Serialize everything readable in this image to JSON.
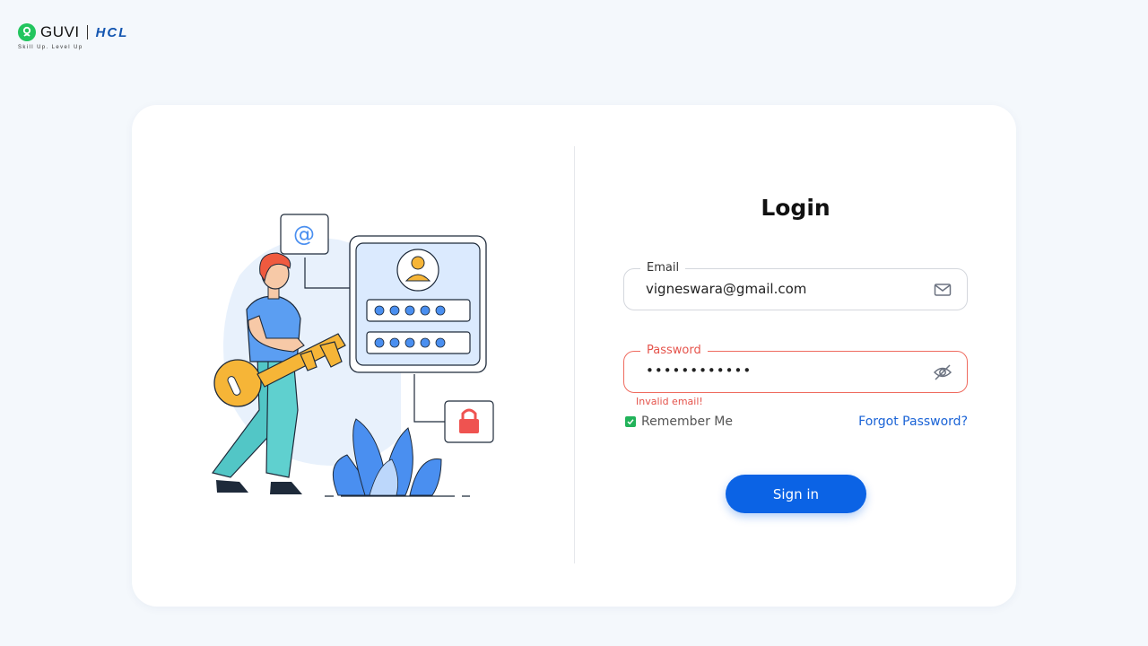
{
  "brand": {
    "name": "GUVI",
    "partner": "HCL",
    "tagline": "Skill Up. Level Up",
    "guvi_color": "#22c55e",
    "hcl_color": "#1255b0"
  },
  "login": {
    "title": "Login",
    "email": {
      "label": "Email",
      "value": "vigneswara@gmail.com",
      "icon": "mail-icon"
    },
    "password": {
      "label": "Password",
      "value": "••••••••••••",
      "icon": "eye-slash-icon",
      "error": "Invalid email!",
      "error_color": "#e5534b"
    },
    "remember_me": {
      "label": "Remember Me",
      "checked": true
    },
    "forgot_password": "Forgot Password?",
    "submit_label": "Sign in",
    "accent_color": "#0b63e5"
  }
}
